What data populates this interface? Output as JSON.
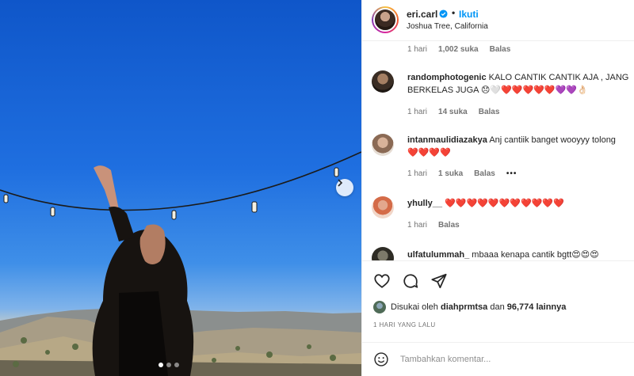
{
  "post": {
    "username": "eri.carl",
    "dot": "•",
    "follow_label": "Ikuti",
    "location": "Joshua Tree, California",
    "verified": true
  },
  "top_meta": {
    "time": "1 hari",
    "likes": "1,002 suka",
    "reply": "Balas"
  },
  "comments": [
    {
      "username": "randomphotogenic",
      "text_line1": "KALO CANTIK CANTIK AJA , JANG",
      "text_line2": "BERKELAS JUGA 😞🤍❤️❤️❤️❤️❤️💜💜👌🏻",
      "time": "1 hari",
      "likes": "14 suka",
      "reply": "Balas"
    },
    {
      "username": "intanmaulidiazakya",
      "text_line1": "Anj cantiik banget wooyyy tolong",
      "text_line2": "❤️❤️❤️❤️",
      "time": "1 hari",
      "likes": "1 suka",
      "reply": "Balas",
      "more": "•••"
    },
    {
      "username": "yhully__",
      "text_line1": "❤️❤️❤️❤️❤️❤️❤️❤️❤️❤️❤️",
      "time": "1 hari",
      "reply": "Balas"
    },
    {
      "username": "ulfatulummah_",
      "text_line1": "mbaaa kenapa cantik bgtt😍😍😍"
    }
  ],
  "likes_line": {
    "prefix": "Disukai oleh",
    "user": "diahprmtsa",
    "middle": "dan",
    "count": "96,774 lainnya"
  },
  "date": "1 HARI YANG LALU",
  "add_comment": {
    "placeholder": "Tambahkan komentar..."
  },
  "colors": {
    "accent": "#0095f6",
    "verified": "#0095f6",
    "text": "#262626",
    "muted": "#737373"
  },
  "icons": [
    "verified-badge-icon",
    "chevron-right-icon",
    "heart-icon",
    "comment-icon",
    "share-icon",
    "emoji-icon"
  ]
}
